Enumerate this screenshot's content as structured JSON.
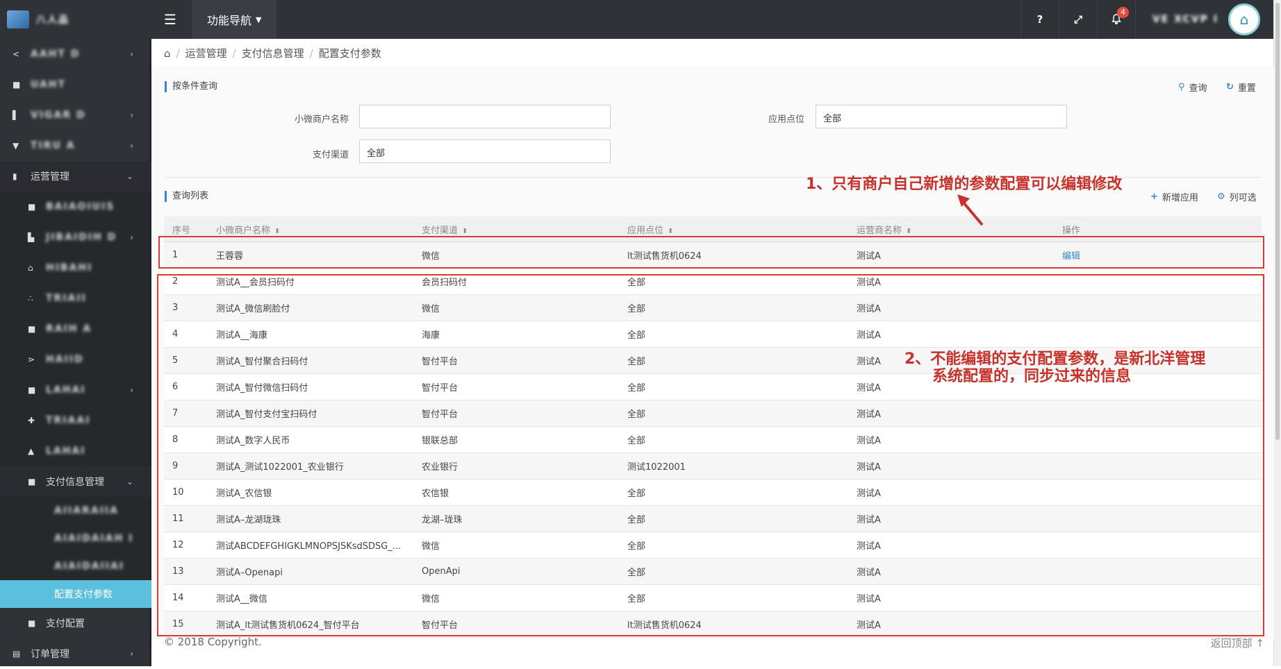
{
  "topbar": {
    "brand": "八人品",
    "func_nav": "功能导航",
    "help_icon": "?",
    "notif_count": "4",
    "user_name": "VE XCVP I"
  },
  "sidebar": {
    "items": [
      {
        "label": "AAHT D",
        "icon": "back-icon",
        "arrow": "›"
      },
      {
        "label": "UAHT",
        "icon": "square-icon"
      },
      {
        "label": "VIGAR D",
        "icon": "bar-icon",
        "arrow": "›"
      },
      {
        "label": "TIRU A",
        "icon": "tag-icon",
        "arrow": "›"
      },
      {
        "label": "运营管理",
        "icon": "bookmark-icon",
        "arrow": "⌄"
      }
    ],
    "sub_items": [
      {
        "label": "BAIAOIUIS",
        "icon": "square-icon"
      },
      {
        "label": "JIBAIDIH D",
        "icon": "doc-icon",
        "arrow": "›"
      },
      {
        "label": "HIBAHI",
        "icon": "tree-icon"
      },
      {
        "label": "TRIAII",
        "icon": "dot-icon"
      },
      {
        "label": "RAIH A",
        "icon": "square-icon"
      },
      {
        "label": "HAIID",
        "icon": "share-icon"
      },
      {
        "label": "LAHAI",
        "icon": "square-icon",
        "arrow": "›"
      },
      {
        "label": "TRIAAI",
        "icon": "plus-icon"
      },
      {
        "label": "LAHAI",
        "icon": "lock-icon"
      },
      {
        "label": "支付信息管理",
        "icon": "square-icon",
        "arrow": "⌄"
      }
    ],
    "sub2_items": [
      {
        "label": "AIIARAIIA"
      },
      {
        "label": "AIAIDAIAH I"
      },
      {
        "label": "AIAIDAIIAI"
      },
      {
        "label": "配置支付参数",
        "active": true
      }
    ],
    "bottom_items": [
      {
        "label": "支付配置",
        "icon": "square-icon"
      },
      {
        "label": "订单管理",
        "icon": "list-icon",
        "arrow": "›"
      }
    ]
  },
  "breadcrumb": [
    "运营管理",
    "支付信息管理",
    "配置支付参数"
  ],
  "query": {
    "title": "按条件查询",
    "search_label": "查询",
    "reset_label": "重置",
    "merchant_label": "小微商户名称",
    "merchant_value": "",
    "point_label": "应用点位",
    "point_value": "全部",
    "channel_label": "支付渠道",
    "channel_value": "全部"
  },
  "list": {
    "title": "查询列表",
    "add_label": "新增应用",
    "columns_label": "列可选",
    "headers": [
      "序号",
      "小微商户名称",
      "支付渠道",
      "应用点位",
      "运营商名称",
      "操作"
    ],
    "rows": [
      [
        "1",
        "王蓉蓉",
        "微信",
        "lt测试售货机0624",
        "测试A",
        "编辑"
      ],
      [
        "2",
        "测试A__会员扫码付",
        "会员扫码付",
        "全部",
        "测试A",
        ""
      ],
      [
        "3",
        "测试A_微信刷脸付",
        "微信",
        "全部",
        "测试A",
        ""
      ],
      [
        "4",
        "测试A__海康",
        "海康",
        "全部",
        "测试A",
        ""
      ],
      [
        "5",
        "测试A_智付聚合扫码付",
        "智付平台",
        "全部",
        "测试A",
        ""
      ],
      [
        "6",
        "测试A_智付微信扫码付",
        "智付平台",
        "全部",
        "测试A",
        ""
      ],
      [
        "7",
        "测试A_智付支付宝扫码付",
        "智付平台",
        "全部",
        "测试A",
        ""
      ],
      [
        "8",
        "测试A_数字人民币",
        "银联总部",
        "全部",
        "测试A",
        ""
      ],
      [
        "9",
        "测试A_测试1022001_农业银行",
        "农业银行",
        "测试1022001",
        "测试A",
        ""
      ],
      [
        "10",
        "测试A_农信银",
        "农信银",
        "全部",
        "测试A",
        ""
      ],
      [
        "11",
        "测试A–龙湖珑珠",
        "龙湖–珑珠",
        "全部",
        "测试A",
        ""
      ],
      [
        "12",
        "测试ABCDEFGHIGKLMNOPSJSKsdSDSG_...",
        "微信",
        "全部",
        "测试A",
        ""
      ],
      [
        "13",
        "测试A–Openapi",
        "OpenApi",
        "全部",
        "测试A",
        ""
      ],
      [
        "14",
        "测试A__微信",
        "微信",
        "全部",
        "测试A",
        ""
      ],
      [
        "15",
        "测试A_lt测试售货机0624_智付平台",
        "智付平台",
        "lt测试售货机0624",
        "测试A",
        ""
      ]
    ]
  },
  "annotations": {
    "note1": "1、只有商户自己新增的参数配置可以编辑修改",
    "note2_line1": "2、不能编辑的支付配置参数，是新北洋管理",
    "note2_line2": "系统配置的，同步过来的信息"
  },
  "footer": {
    "copyright": "© 2018 Copyright.",
    "back_top": "返回顶部"
  },
  "colors": {
    "accent": "#3a87c8",
    "sidebar_bg": "#2f3237",
    "active_item": "#5bc0de",
    "annotation_red": "#d63a30"
  }
}
